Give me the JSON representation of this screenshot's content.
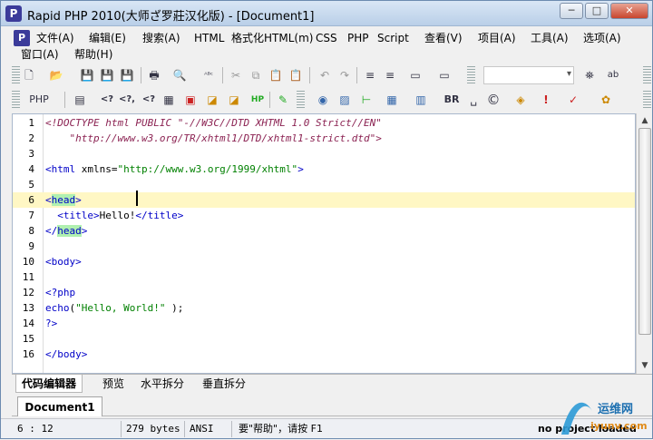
{
  "window": {
    "title": "Rapid PHP 2010(大师ざ罗莊汉化版) - [Document1]",
    "app_icon_glyph": "P",
    "buttons": {
      "minimize": "─",
      "maximize": "□",
      "close": "✕"
    }
  },
  "menu": {
    "row1": [
      "文件(A)",
      "编辑(E)",
      "搜索(A)",
      "HTML",
      "格式化HTML(m)",
      "CSS",
      "PHP",
      "Script",
      "查看(V)",
      "项目(A)",
      "工具(A)",
      "选项(A)"
    ],
    "row2": [
      "窗口(A)",
      "帮助(H)"
    ]
  },
  "toolbar1": {
    "icons": [
      "new-file-icon",
      "open-folder-icon",
      "save-icon",
      "save-all-icon",
      "save-as-icon",
      "print-icon",
      "preview-icon",
      "spellcheck-icon",
      "cut-icon",
      "copy-icon",
      "paste-icon",
      "clipboard-icon",
      "undo-icon",
      "redo-icon",
      "indent-icon",
      "outdent-icon",
      "window-icon",
      "layout-icon",
      "binoculars-icon",
      "replace-icon"
    ],
    "glyphs": [
      "🗋",
      "📂",
      "💾",
      "💾",
      "💾",
      "🖶",
      "🔍",
      "ᴬᴮᶜ",
      "✂",
      "⧉",
      "📋",
      "📋",
      "↶",
      "↷",
      "≡",
      "≡",
      "▭",
      "▭",
      "⛯",
      "ab"
    ],
    "search_combo_value": ""
  },
  "toolbar2": {
    "php_label": "PHP",
    "icons": [
      "php-snippet-icon",
      "form-icon",
      "echo-tag-icon",
      "short-echo-icon",
      "php-tag-icon",
      "table-icon",
      "image-tag-icon",
      "link-icon",
      "hp-icon",
      "validate-icon",
      "globe-icon",
      "image-icon",
      "tree-icon",
      "grid-icon",
      "frame-icon",
      "br-icon",
      "nbsp-icon",
      "copyright-icon",
      "tools-icon",
      "alert-icon",
      "brush-icon",
      "paint-icon"
    ],
    "glyphs": [
      "{?}",
      "▤",
      "<?",
      "<?,",
      "<?=",
      "▦",
      "▣",
      "◪",
      "HP",
      "✎",
      "◉",
      "▨",
      "⊢",
      "▦",
      "▥",
      "BR",
      "␣",
      "©",
      "◈",
      "!",
      "✓",
      "✿"
    ]
  },
  "editor": {
    "lines": [
      {
        "n": "1",
        "parts": [
          {
            "t": "<!DOCTYPE html PUBLIC \"-//W3C//DTD XHTML 1.0 Strict//EN\"",
            "c": "c-comment"
          }
        ]
      },
      {
        "n": "2",
        "parts": [
          {
            "t": "    \"http://www.w3.org/TR/xhtml1/DTD/xhtml1-strict.dtd\">",
            "c": "c-comment"
          }
        ]
      },
      {
        "n": "3",
        "parts": []
      },
      {
        "n": "4",
        "parts": [
          {
            "t": "<html ",
            "c": "c-tag"
          },
          {
            "t": "xmlns",
            "c": "c-attr"
          },
          {
            "t": "=",
            "c": "c-plain"
          },
          {
            "t": "\"http://www.w3.org/1999/xhtml\"",
            "c": "c-str"
          },
          {
            "t": ">",
            "c": "c-tag"
          }
        ]
      },
      {
        "n": "5",
        "parts": []
      },
      {
        "n": "6",
        "parts": [
          {
            "t": "<",
            "c": "c-tag"
          },
          {
            "t": "head",
            "c": "c-tag c-head"
          },
          {
            "t": ">",
            "c": "c-tag"
          }
        ],
        "highlight": true
      },
      {
        "n": "7",
        "parts": [
          {
            "t": "  <title>",
            "c": "c-tag"
          },
          {
            "t": "Hello!",
            "c": "c-plain"
          },
          {
            "t": "</title>",
            "c": "c-tag"
          }
        ]
      },
      {
        "n": "8",
        "parts": [
          {
            "t": "</",
            "c": "c-tag"
          },
          {
            "t": "head",
            "c": "c-tag c-head"
          },
          {
            "t": ">",
            "c": "c-tag"
          }
        ]
      },
      {
        "n": "9",
        "parts": []
      },
      {
        "n": "10",
        "parts": [
          {
            "t": "<body>",
            "c": "c-tag"
          }
        ]
      },
      {
        "n": "11",
        "parts": []
      },
      {
        "n": "12",
        "parts": [
          {
            "t": "<?php",
            "c": "c-php"
          }
        ]
      },
      {
        "n": "13",
        "parts": [
          {
            "t": "echo",
            "c": "c-php"
          },
          {
            "t": "(",
            "c": "c-plain"
          },
          {
            "t": "\"Hello, World!\"",
            "c": "c-str"
          },
          {
            "t": " );",
            "c": "c-plain"
          }
        ]
      },
      {
        "n": "14",
        "parts": [
          {
            "t": "?>",
            "c": "c-php"
          }
        ]
      },
      {
        "n": "15",
        "parts": []
      },
      {
        "n": "16",
        "parts": [
          {
            "t": "</body>",
            "c": "c-tag"
          }
        ]
      }
    ]
  },
  "view_tabs": [
    "代码编辑器",
    "预览",
    "水平拆分",
    "垂直拆分"
  ],
  "document_tab": "Document1",
  "status": {
    "position": "6 : 12",
    "size": "279 bytes",
    "encoding": "ANSI",
    "hint": "要\"帮助\"，请按 F1",
    "project": "no project loaded"
  },
  "watermark": {
    "text": "运维网",
    "url": "iyunv.com"
  }
}
